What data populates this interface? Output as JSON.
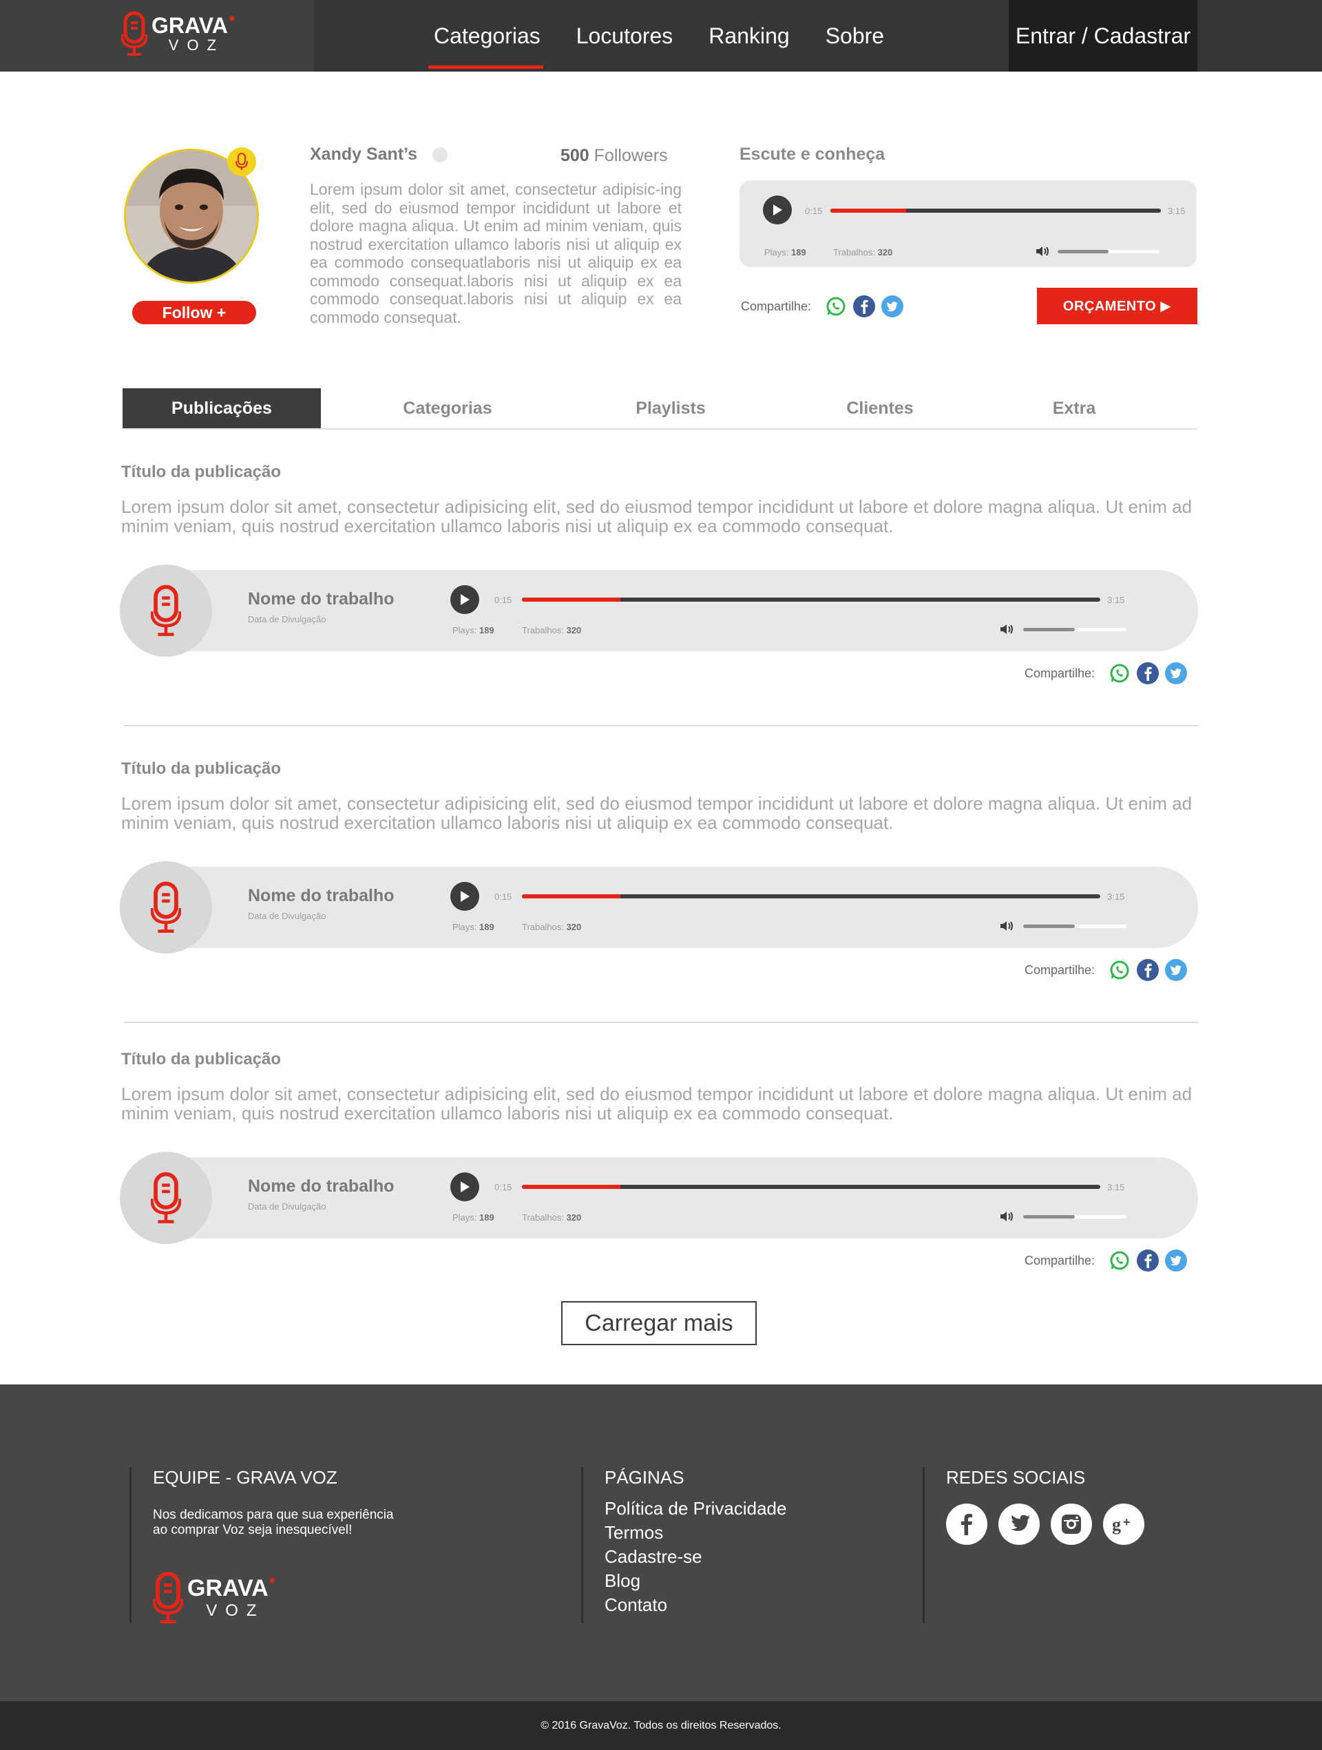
{
  "header": {
    "logo": {
      "word": "GRAVA",
      "sub": "VOZ"
    },
    "nav": [
      {
        "label": "Categorias",
        "active": true
      },
      {
        "label": "Locutores",
        "active": false
      },
      {
        "label": "Ranking",
        "active": false
      },
      {
        "label": "Sobre",
        "active": false
      }
    ],
    "login_label": "Entrar / Cadastrar"
  },
  "profile": {
    "name": "Xandy Sant’s",
    "followers_count": "500",
    "followers_label": "Followers",
    "bio": "Lorem ipsum dolor sit amet, consectetur adipisic-ing elit, sed do eiusmod tempor incididunt ut labore et dolore magna aliqua. Ut enim ad minim veniam, quis nostrud exercitation ullamco laboris nisi ut aliquip ex ea commodo consequatlaboris nisi ut aliquip ex ea commodo consequat.laboris nisi ut aliquip ex ea commodo consequat.laboris nisi ut aliquip ex ea commodo consequat.",
    "follow_label": "Follow +",
    "listen_title": "Escute e conheça",
    "player": {
      "current_time": "0:15",
      "duration": "3:15",
      "progress": 0.23,
      "volume": 0.5,
      "plays_label": "Plays:",
      "plays": "189",
      "works_label": "Trabalhos:",
      "works": "320"
    },
    "share_label": "Compartilhe:",
    "budget_label": "ORÇAMENTO ▶"
  },
  "tabs": [
    {
      "label": "Publicações",
      "active": true
    },
    {
      "label": "Categorias",
      "active": false
    },
    {
      "label": "Playlists",
      "active": false
    },
    {
      "label": "Clientes",
      "active": false
    },
    {
      "label": "Extra",
      "active": false
    }
  ],
  "posts": [
    {
      "title": "Título da publicação",
      "text": "Lorem ipsum dolor sit amet, consectetur adipisicing elit, sed do eiusmod tempor incididunt ut labore et dolore magna aliqua. Ut enim ad minim veniam, quis nostrud exercitation ullamco laboris nisi ut aliquip ex ea commodo consequat.",
      "work_name": "Nome do trabalho",
      "work_date": "Data de Divulgação",
      "current_time": "0:15",
      "duration": "3:15",
      "progress": 0.17,
      "volume": 0.5,
      "plays_label": "Plays:",
      "plays": "189",
      "works_label": "Trabalhos:",
      "works": "320",
      "share_label": "Compartilhe:"
    },
    {
      "title": "Título da publicação",
      "text": "Lorem ipsum dolor sit amet, consectetur adipisicing elit, sed do eiusmod tempor incididunt ut labore et dolore magna aliqua. Ut enim ad minim veniam, quis nostrud exercitation ullamco laboris nisi ut aliquip ex ea commodo consequat.",
      "work_name": "Nome do trabalho",
      "work_date": "Data de Divulgação",
      "current_time": "0:15",
      "duration": "3:15",
      "progress": 0.17,
      "volume": 0.5,
      "plays_label": "Plays:",
      "plays": "189",
      "works_label": "Trabalhos:",
      "works": "320",
      "share_label": "Compartilhe:"
    },
    {
      "title": "Título da publicação",
      "text": "Lorem ipsum dolor sit amet, consectetur adipisicing elit, sed do eiusmod tempor incididunt ut labore et dolore magna aliqua. Ut enim ad minim veniam, quis nostrud exercitation ullamco laboris nisi ut aliquip ex ea commodo consequat.",
      "work_name": "Nome do trabalho",
      "work_date": "Data de Divulgação",
      "current_time": "0:15",
      "duration": "3:15",
      "progress": 0.17,
      "volume": 0.5,
      "plays_label": "Plays:",
      "plays": "189",
      "works_label": "Trabalhos:",
      "works": "320",
      "share_label": "Compartilhe:"
    }
  ],
  "load_more_label": "Carregar mais",
  "footer": {
    "team_title": "EQUIPE - GRAVA VOZ",
    "team_desc_1": "Nos dedicamos para que sua experiência",
    "team_desc_2": "ao comprar Voz seja inesquecível!",
    "logo": {
      "word": "GRAVA",
      "sub": "VOZ"
    },
    "pages_title": "PÁGINAS",
    "pages": [
      "Política de Privacidade",
      "Termos",
      "Cadastre-se",
      "Blog",
      "Contato"
    ],
    "social_title": "REDES SOCIAIS",
    "social_icons": [
      "facebook-icon",
      "twitter-icon",
      "instagram-icon",
      "google-plus-icon"
    ]
  },
  "copyright": "© 2016 GravaVoz. Todos os direitos Reservados.",
  "colors": {
    "accent": "#e42517",
    "dark": "#363636",
    "badge": "#f3d21c",
    "whatsapp": "#2fb94b",
    "facebook": "#3b5a9a",
    "twitter": "#4ca5e6"
  }
}
